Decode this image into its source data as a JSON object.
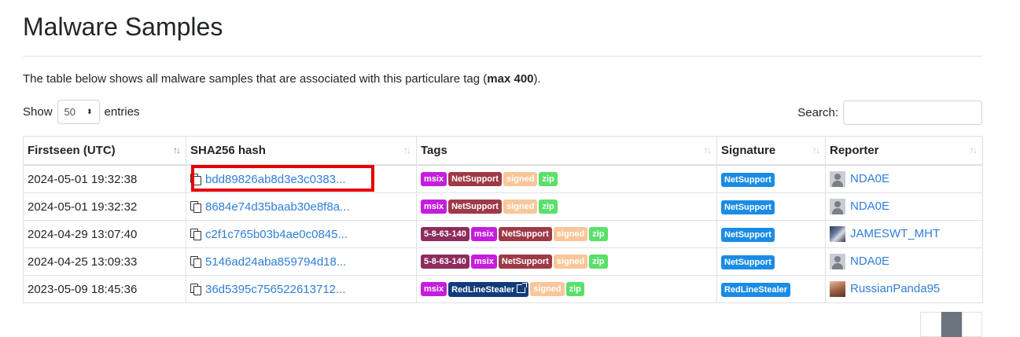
{
  "page": {
    "title": "Malware Samples",
    "description_pre": "The table below shows all malware samples that are associated with this particulare tag (",
    "description_bold": "max 400",
    "description_post": ")."
  },
  "length_menu": {
    "show_label": "Show",
    "value": "50",
    "entries_label": "entries"
  },
  "search": {
    "label": "Search:",
    "value": ""
  },
  "table": {
    "columns": [
      "Firstseen (UTC)",
      "SHA256 hash",
      "Tags",
      "Signature",
      "Reporter"
    ],
    "rows": [
      {
        "firstseen": "2024-05-01 19:32:38",
        "hash": "bdd89826ab8d3e3c0383...",
        "tags": [
          {
            "label": "msix",
            "kind": "msix"
          },
          {
            "label": "NetSupport",
            "kind": "net"
          },
          {
            "label": "signed",
            "kind": "signed"
          },
          {
            "label": "zip",
            "kind": "zip"
          }
        ],
        "signature": "NetSupport",
        "reporter": "NDA0E",
        "avatar": "default-avatar"
      },
      {
        "firstseen": "2024-05-01 19:32:32",
        "hash": "8684e74d35baab30e8f8a...",
        "tags": [
          {
            "label": "msix",
            "kind": "msix"
          },
          {
            "label": "NetSupport",
            "kind": "net"
          },
          {
            "label": "signed",
            "kind": "signed"
          },
          {
            "label": "zip",
            "kind": "zip"
          }
        ],
        "signature": "NetSupport",
        "reporter": "NDA0E",
        "avatar": "default-avatar"
      },
      {
        "firstseen": "2024-04-29 13:07:40",
        "hash": "c2f1c765b03b4ae0c0845...",
        "tags": [
          {
            "label": "5-8-63-140",
            "kind": "ver"
          },
          {
            "label": "msix",
            "kind": "msix"
          },
          {
            "label": "NetSupport",
            "kind": "net"
          },
          {
            "label": "signed",
            "kind": "signed"
          },
          {
            "label": "zip",
            "kind": "zip"
          }
        ],
        "signature": "NetSupport",
        "reporter": "JAMESWT_MHT",
        "avatar": "photo-avatar"
      },
      {
        "firstseen": "2024-04-25 13:09:33",
        "hash": "5146ad24aba859794d18...",
        "tags": [
          {
            "label": "5-8-63-140",
            "kind": "ver"
          },
          {
            "label": "msix",
            "kind": "msix"
          },
          {
            "label": "NetSupport",
            "kind": "net"
          },
          {
            "label": "signed",
            "kind": "signed"
          },
          {
            "label": "zip",
            "kind": "zip"
          }
        ],
        "signature": "NetSupport",
        "reporter": "NDA0E",
        "avatar": "default-avatar"
      },
      {
        "firstseen": "2023-05-09 18:45:36",
        "hash": "36d5395c756522613712...",
        "tags": [
          {
            "label": "msix",
            "kind": "msix"
          },
          {
            "label": "RedLineStealer",
            "kind": "red",
            "external": true
          },
          {
            "label": "signed",
            "kind": "signed"
          },
          {
            "label": "zip",
            "kind": "zip"
          }
        ],
        "signature": "RedLineStealer",
        "reporter": "RussianPanda95",
        "avatar": "photo-avatar-2"
      }
    ]
  },
  "colors": {
    "link": "#2f7ed8",
    "tag_msix": "#c41ddd",
    "tag_netsupport": "#9e3a48",
    "tag_signed": "#f8c699",
    "tag_zip": "#59e06a",
    "tag_version": "#8e2c5d",
    "tag_redline": "#123b7a",
    "signature_badge": "#1a8ce4",
    "highlight": "#e60000"
  }
}
